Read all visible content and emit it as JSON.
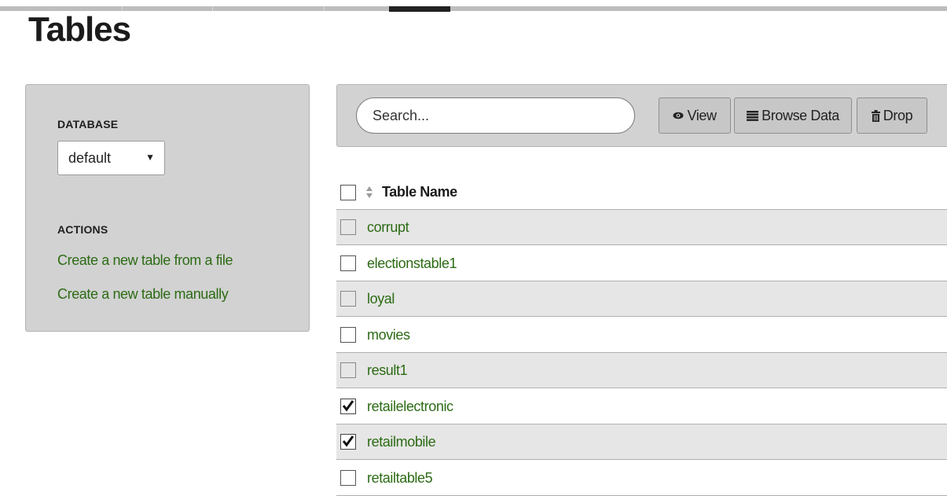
{
  "page": {
    "title": "Tables"
  },
  "sidebar": {
    "database_label": "DATABASE",
    "database_selected": "default",
    "actions_label": "ACTIONS",
    "actions": [
      "Create a new table from a file",
      "Create a new table manually"
    ]
  },
  "toolbar": {
    "search_placeholder": "Search...",
    "view_label": "View",
    "browse_label": "Browse Data",
    "drop_label": "Drop"
  },
  "table": {
    "column_header": "Table Name",
    "rows": [
      {
        "name": "corrupt",
        "checked": false
      },
      {
        "name": "electionstable1",
        "checked": false
      },
      {
        "name": "loyal",
        "checked": false
      },
      {
        "name": "movies",
        "checked": false
      },
      {
        "name": "result1",
        "checked": false
      },
      {
        "name": "retailelectronic",
        "checked": true
      },
      {
        "name": "retailmobile",
        "checked": true
      },
      {
        "name": "retailtable5",
        "checked": false
      }
    ]
  },
  "colors": {
    "link_green": "#2c6b14",
    "panel_gray": "#d2d2d2",
    "stripe_gray": "#e6e6e6"
  },
  "icons": {
    "view": "eye-icon",
    "browse": "list-icon",
    "drop": "trash-icon",
    "sort": "sort-icon",
    "select": "caret-down-icon"
  }
}
